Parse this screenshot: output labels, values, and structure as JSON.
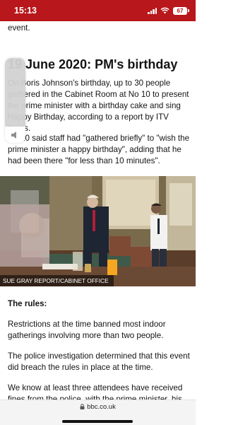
{
  "status": {
    "time": "15:13",
    "battery": "67"
  },
  "article": {
    "top_fragment": "event.",
    "heading": "19 June 2020: PM's birthday",
    "para1": "On Boris Johnson's birthday, up to 30 people gathered in the Cabinet Room at No 10 to present the prime minister with a birthday cake and sing Happy Birthday, according to a report by ITV News.",
    "para2": "No 10 said staff had \"gathered briefly\" to \"wish the prime minister a happy birthday\", adding that he had been there \"for less than 10 minutes\".",
    "photo_credit": "SUE GRAY REPORT/CABINET OFFICE",
    "rules_heading": "The rules:",
    "para3": "Restrictions at the time banned most indoor gatherings involving more than two people.",
    "para4": "The police investigation determined that this event did breach the rules in place at the time.",
    "para5": "We know at least three attendees have received fines from the police, with the prime minister, his"
  },
  "volume": {
    "level_percent": 19
  },
  "browser": {
    "url": "bbc.co.uk"
  },
  "colors": {
    "status_bar": "#b8171b",
    "text": "#141414"
  }
}
